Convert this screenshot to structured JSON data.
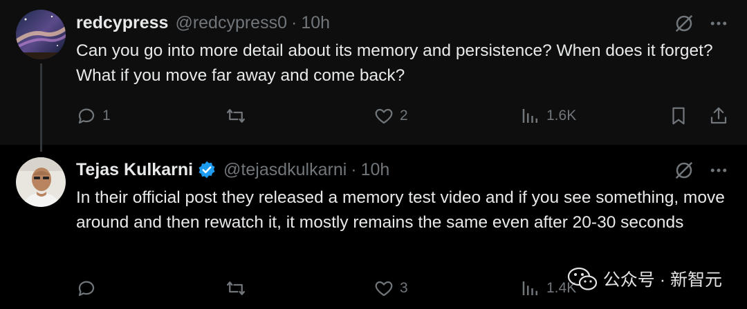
{
  "posts": [
    {
      "name": "redcypress",
      "handle": "@redcypress0",
      "separator": "·",
      "time": "10h",
      "text": "Can you go into more detail about its memory and persistence? When does it forget? What if you move far away and come back?",
      "replies": "1",
      "reposts": "",
      "likes": "2",
      "views": "1.6K",
      "verified": false,
      "avatar_icon": "galaxy-avatar"
    },
    {
      "name": "Tejas Kulkarni",
      "handle": "@tejasdkulkarni",
      "separator": "·",
      "time": "10h",
      "text": "In their official post they released a memory test video and if you see something, move around and then rewatch it, it mostly remains the same even after 20-30 seconds",
      "replies": "",
      "reposts": "",
      "likes": "3",
      "views": "1.4K",
      "verified": true,
      "avatar_icon": "person-avatar"
    }
  ],
  "watermark": {
    "text": "公众号 · 新智元",
    "icon": "wechat-icon"
  },
  "colors": {
    "background": "#000000",
    "text": "#e7e9ea",
    "muted": "#71767b",
    "verified": "#1d9bf0"
  }
}
